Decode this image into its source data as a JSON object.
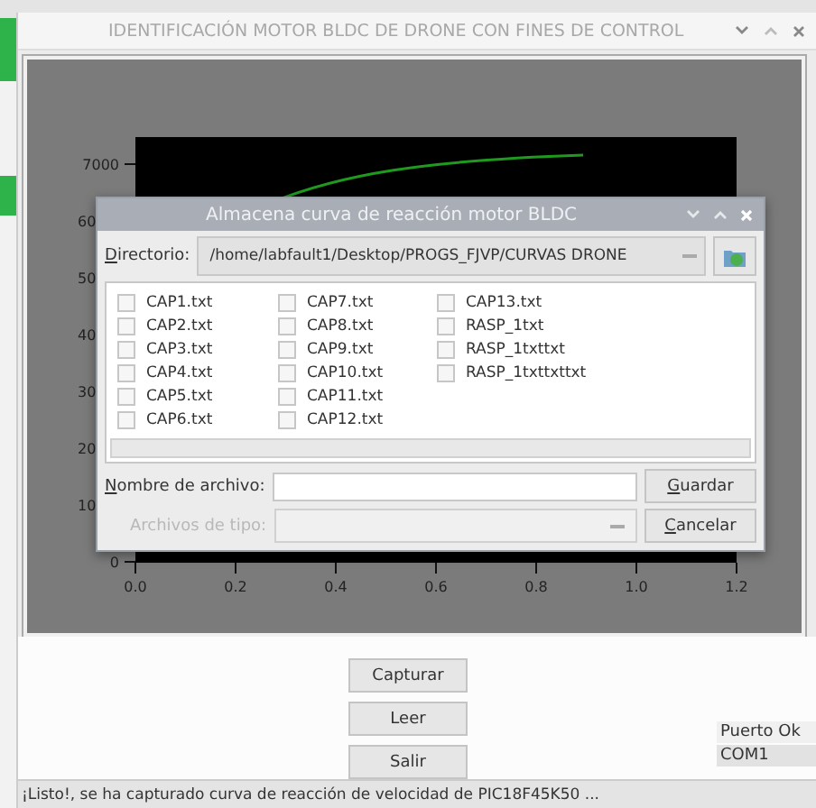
{
  "window": {
    "title": "IDENTIFICACIÓN MOTOR BLDC DE DRONE CON FINES DE CONTROL"
  },
  "plot": {
    "y_ticks": [
      "7000",
      "60",
      "50",
      "40",
      "30",
      "20",
      "10",
      "0"
    ],
    "x_ticks": [
      "0.0",
      "0.2",
      "0.4",
      "0.6",
      "0.8",
      "1.0",
      "1.2"
    ]
  },
  "dialog": {
    "title": "Almacena curva de reacción motor BLDC",
    "directory_label": "Directorio:",
    "directory": "/home/labfault1/Desktop/PROGS_FJVP/CURVAS DRONE",
    "files": [
      {
        "name": "CAP1.txt",
        "checked": false
      },
      {
        "name": "CAP2.txt",
        "checked": false
      },
      {
        "name": "CAP3.txt",
        "checked": false
      },
      {
        "name": "CAP4.txt",
        "checked": false
      },
      {
        "name": "CAP5.txt",
        "checked": false
      },
      {
        "name": "CAP6.txt",
        "checked": false
      },
      {
        "name": "CAP7.txt",
        "checked": false
      },
      {
        "name": "CAP8.txt",
        "checked": false
      },
      {
        "name": "CAP9.txt",
        "checked": false
      },
      {
        "name": "CAP10.txt",
        "checked": false
      },
      {
        "name": "CAP11.txt",
        "checked": false
      },
      {
        "name": "CAP12.txt",
        "checked": false
      },
      {
        "name": "CAP13.txt",
        "checked": false
      },
      {
        "name": "RASP_1txt",
        "checked": false
      },
      {
        "name": "RASP_1txttxt",
        "checked": false
      },
      {
        "name": "RASP_1txttxttxt",
        "checked": false
      }
    ],
    "filename_label": "Nombre de archivo:",
    "filetype": {
      "label": "Archivos de tipo:",
      "disabled": true
    },
    "buttons": [
      "Guardar",
      "Cancelar"
    ]
  },
  "buttons": [
    "Capturar",
    "Leer",
    "Salir"
  ],
  "port": {
    "status": "Puerto Ok",
    "name": "COM1"
  },
  "status_bar": "¡Listo!, se ha capturado curva de reacción de velocidad de PIC18F45K50 ..."
}
